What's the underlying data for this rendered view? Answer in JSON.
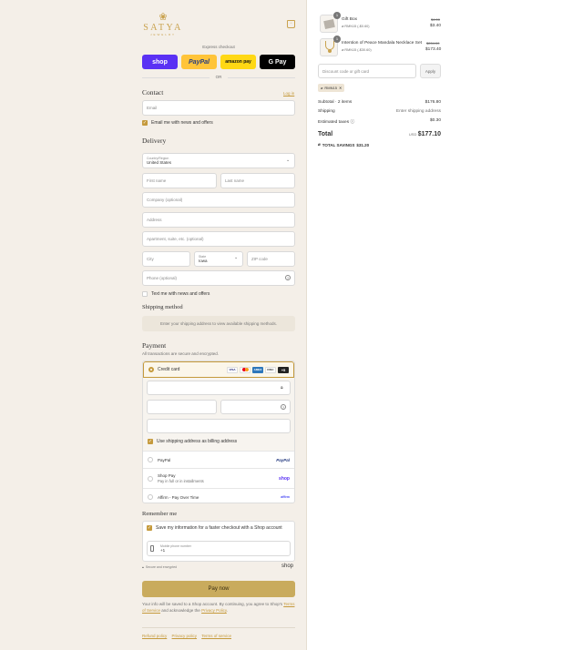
{
  "brand": {
    "name": "SATYA",
    "tagline": "JEWELRY",
    "mark": "❀"
  },
  "express": {
    "title": "Express checkout",
    "shop": "shop",
    "paypal": "PayPal",
    "amazon": "amazon pay",
    "gpay": "G Pay",
    "or": "OR"
  },
  "contact": {
    "title": "Contact",
    "login": "Log in",
    "email_placeholder": "Email",
    "news": "Email me with news and offers"
  },
  "delivery": {
    "title": "Delivery",
    "country_label": "Country/Region",
    "country": "United States",
    "first": "First name",
    "last": "Last name",
    "company": "Company (optional)",
    "address": "Address",
    "apt": "Apartment, suite, etc. (optional)",
    "city": "City",
    "state_label": "State",
    "state": "Iowa",
    "zip": "ZIP code",
    "phone": "Phone (optional)",
    "text_news": "Text me with news and offers"
  },
  "shipping": {
    "title": "Shipping method",
    "message": "Enter your shipping address to view available shipping methods."
  },
  "payment": {
    "title": "Payment",
    "subtitle": "All transactions are secure and encrypted.",
    "credit": "Credit card",
    "more": "+5",
    "billing": "Use shipping address as billing address",
    "paypal": "PayPal",
    "paypal_logo": "PayPal",
    "shoppay": "Shop Pay",
    "shoppay_sub": "Pay in full or in installments",
    "shoppay_logo": "shop",
    "affirm": "Affirm - Pay Over Time",
    "affirm_logo": "affirm"
  },
  "remember": {
    "title": "Remember me",
    "save": "Save my information for a faster checkout with a Shop account",
    "phone_label": "Mobile phone number",
    "phone_value": "+1",
    "secure": "Secure and encrypted",
    "shop": "shop"
  },
  "pay_now": "Pay now",
  "legal": {
    "text": "Your info will be saved to a Shop account. By continuing, you agree to Shop's",
    "terms": "Terms of Service",
    "mid": "and acknowledge the",
    "privacy": "Privacy Policy",
    "end": "."
  },
  "footer": {
    "refund": "Refund policy",
    "privacy": "Privacy policy",
    "terms": "Terms of service"
  },
  "cart": {
    "items": [
      {
        "name": "Gift Box",
        "qty": "1",
        "discount": "RMN15 (-$0.60)",
        "orig": "$4.00",
        "price": "$3.40"
      },
      {
        "name": "Intention of Peace Mandala Necklace Set",
        "qty": "1",
        "discount": "RMN15 (-$30.60)",
        "orig": "$204.00",
        "price": "$173.40"
      }
    ],
    "discount_placeholder": "Discount code or gift card",
    "apply": "Apply",
    "code": "RMN15",
    "subtotal_label": "Subtotal · 2 items",
    "subtotal": "$176.80",
    "shipping_label": "Shipping",
    "shipping": "Enter shipping address",
    "tax_label": "Estimated taxes",
    "tax": "$0.30",
    "total_label": "Total",
    "currency": "USD",
    "total": "$177.10",
    "savings_label": "TOTAL SAVINGS",
    "savings": "$31.20"
  }
}
